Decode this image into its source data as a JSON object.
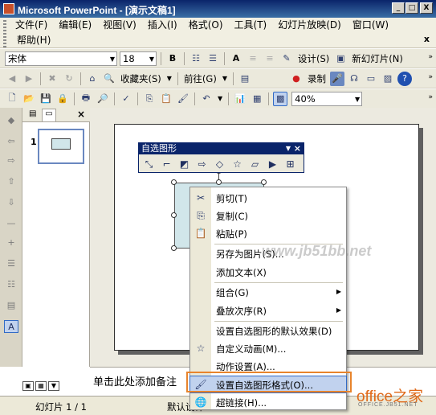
{
  "window": {
    "title": "Microsoft PowerPoint - [演示文稿1]",
    "minimize": "_",
    "restore": "□",
    "close": "X"
  },
  "menubar": {
    "items": [
      "文件(F)",
      "编辑(E)",
      "视图(V)",
      "插入(I)",
      "格式(O)",
      "工具(T)",
      "幻灯片放映(D)",
      "窗口(W)"
    ],
    "help": "帮助(H)",
    "doc_close": "x"
  },
  "formatting_toolbar": {
    "font": "宋体",
    "size": "18",
    "bold": "B",
    "grow_font": "A",
    "design_label": "设计(S)",
    "new_slide_label": "新幻灯片(N)"
  },
  "web_toolbar": {
    "favorites_label": "收藏夹(S)",
    "goto_label": "前往(G)",
    "record_label": "录制"
  },
  "standard_toolbar": {
    "zoom": "40%"
  },
  "thumbnail_pane": {
    "slide_number": "1",
    "close": "×"
  },
  "autoshape_toolbar": {
    "title": "自选图形"
  },
  "context_menu": {
    "items": [
      {
        "label": "剪切(T)",
        "icon": "scissors-icon",
        "glyph": "✂"
      },
      {
        "label": "复制(C)",
        "icon": "copy-icon",
        "glyph": "⎘"
      },
      {
        "label": "粘贴(P)",
        "icon": "paste-icon",
        "glyph": "📋"
      },
      {
        "label": "另存为图片(S)...",
        "icon": "",
        "glyph": ""
      },
      {
        "label": "添加文本(X)",
        "icon": "",
        "glyph": ""
      },
      {
        "label": "组合(G)",
        "icon": "",
        "glyph": "",
        "submenu": true
      },
      {
        "label": "叠放次序(R)",
        "icon": "",
        "glyph": "",
        "submenu": true
      },
      {
        "label": "设置自选图形的默认效果(D)",
        "icon": "",
        "glyph": ""
      },
      {
        "label": "自定义动画(M)...",
        "icon": "custom-animation-icon",
        "glyph": "☆"
      },
      {
        "label": "动作设置(A)...",
        "icon": "",
        "glyph": ""
      },
      {
        "label": "设置自选图形格式(O)...",
        "icon": "format-shape-icon",
        "glyph": "🖌"
      },
      {
        "label": "超链接(H)...",
        "icon": "hyperlink-icon",
        "glyph": "🌐"
      }
    ]
  },
  "notes": {
    "placeholder": "单击此处添加备注"
  },
  "statusbar": {
    "slide_info": "幻灯片 1 / 1",
    "design_info": "默认设计"
  },
  "watermark": {
    "text": "www.jb51bb.net"
  },
  "logo": {
    "main": "office之家",
    "sub": "OFFICE.JB51.NET"
  },
  "colors": {
    "titlebar": "#0a246a",
    "menu_bg": "#f1efe2",
    "highlight_border": "#e8842c",
    "shape_fill": "#d1e6ea"
  }
}
